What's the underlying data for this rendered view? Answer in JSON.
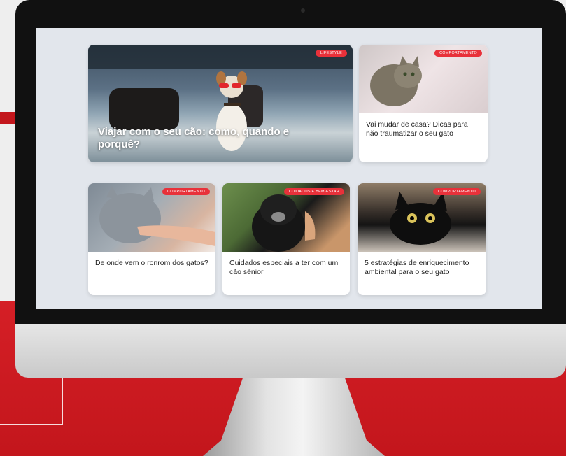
{
  "cards": {
    "feature": {
      "title": "Viajar com o seu cão: como, quando e porquê?",
      "badge": "Lifestyle"
    },
    "moving_cat": {
      "title": "Vai mudar de casa? Dicas para não traumatizar o seu gato",
      "badge": "Comportamento"
    },
    "purring": {
      "title": "De onde vem o ronrom dos gatos?",
      "badge": "Comportamento"
    },
    "senior_dog": {
      "title": "Cuidados especiais a ter com um cão sénior",
      "badge": "Cuidados e bem-estar"
    },
    "enrichment": {
      "title": "5 estratégias de enriquecimento ambiental para o seu gato",
      "badge": "Comportamento"
    }
  },
  "colors": {
    "accent": "#e8313a",
    "brand_red": "#d51f26",
    "screen_bg": "#e2e6ec"
  }
}
